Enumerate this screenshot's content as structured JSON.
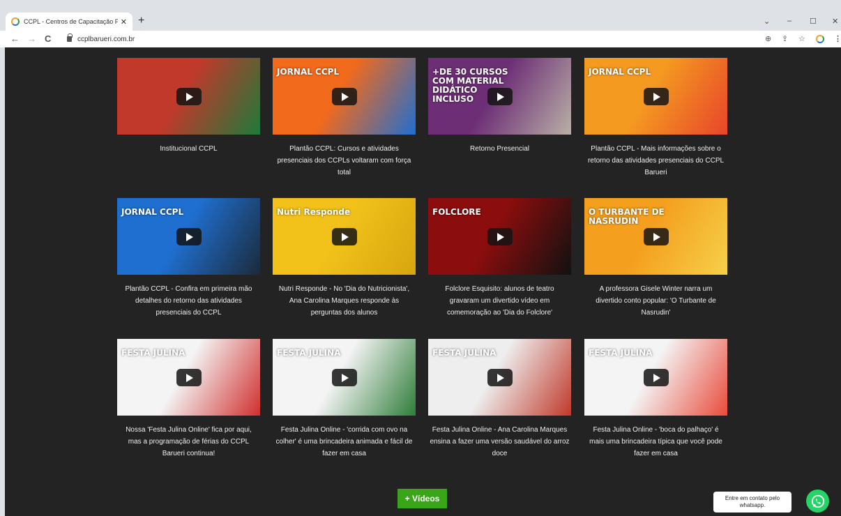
{
  "browser": {
    "tab_title": "CCPL - Centros de Capacitação P",
    "tab_close": "✕",
    "new_tab": "+",
    "url": "ccplbarueri.com.br",
    "controls": {
      "minimize": "–",
      "maximize": "☐",
      "close": "✕",
      "dropdown": "⌄"
    },
    "nav": {
      "back": "←",
      "forward": "→",
      "reload": "C"
    },
    "toolbar_icons": {
      "zoom": "⊕",
      "share": "⇪",
      "star": "☆",
      "menu": "⋮"
    }
  },
  "videos": [
    {
      "caption": "Institucional CCPL",
      "thumb_text": "",
      "colors": [
        "#c0392b",
        "#1e7a3a"
      ]
    },
    {
      "caption": "Plantão CCPL: Cursos e atividades presenciais dos CCPLs voltaram com força total",
      "thumb_text": "JORNAL CCPL",
      "colors": [
        "#f26a1b",
        "#1f6fd0"
      ]
    },
    {
      "caption": "Retorno Presencial",
      "thumb_text": "+DE 30 CURSOS COM MATERIAL DIDÁTICO INCLUSO",
      "colors": [
        "#6d2e76",
        "#b9b0a7"
      ]
    },
    {
      "caption": "Plantão CCPL - Mais informações sobre o retorno das atividades presenciais do CCPL Barueri",
      "thumb_text": "JORNAL CCPL",
      "colors": [
        "#f49a21",
        "#e8452a"
      ]
    },
    {
      "caption": "Plantão CCPL - Confira em primeira mão detalhes do retorno das atividades presenciais do CCPL",
      "thumb_text": "JORNAL CCPL",
      "colors": [
        "#1f6fd0",
        "#1b2a3a"
      ]
    },
    {
      "caption": "Nutri Responde - No 'Dia do Nutricionista', Ana Carolina Marques responde às perguntas dos alunos",
      "thumb_text": "Nutri Responde",
      "colors": [
        "#f2c21b",
        "#d6a60f"
      ]
    },
    {
      "caption": "Folclore Esquisito: alunos de teatro gravaram um divertido vídeo em comemoração ao 'Dia do Folclore'",
      "thumb_text": "FOLCLORE",
      "colors": [
        "#8b0d0d",
        "#111111"
      ]
    },
    {
      "caption": "A professora Gisele Winter narra um divertido conto popular: 'O Turbante de Nasrudin'",
      "thumb_text": "O TURBANTE DE NASRUDIN",
      "colors": [
        "#f4a01e",
        "#f6d04a"
      ]
    },
    {
      "caption": "Nossa 'Festa Julina Online' fica por aqui, mas a programação de férias do CCPL Barueri continua!",
      "thumb_text": "FESTA JULINA",
      "colors": [
        "#f4f4f4",
        "#d12f2f"
      ]
    },
    {
      "caption": "Festa Julina Online - 'corrida com ovo na colher' é uma brincadeira animada e fácil de fazer em casa",
      "thumb_text": "FESTA JULINA",
      "colors": [
        "#f4f4f4",
        "#2f7d3a"
      ]
    },
    {
      "caption": "Festa Julina Online - Ana Carolina Marques ensina a fazer uma versão saudável do arroz doce",
      "thumb_text": "FESTA JULINA",
      "colors": [
        "#eeeeee",
        "#c0392b"
      ]
    },
    {
      "caption": "Festa Julina Online - 'boca do palhaço' é mais uma brincadeira típica que você pode fazer em casa",
      "thumb_text": "FESTA JULINA",
      "colors": [
        "#f4f4f4",
        "#e94b3c"
      ]
    }
  ],
  "more_button": "+ Vídeos",
  "whatsapp": {
    "tooltip": "Entre em contato pelo whatsapp."
  }
}
